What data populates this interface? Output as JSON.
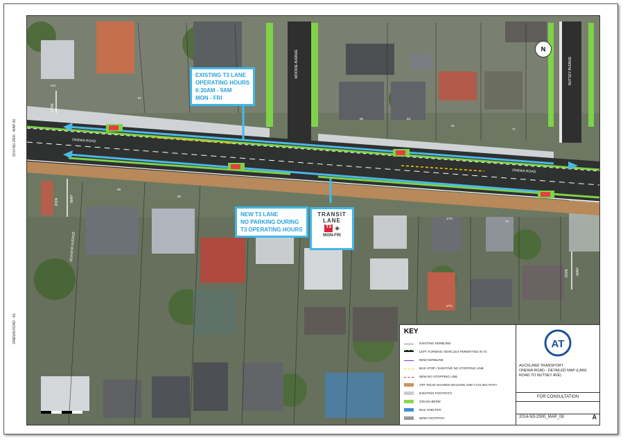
{
  "map": {
    "roads": {
      "main": "ONEWA ROAD",
      "main_right": "ONEWA ROAD",
      "side1": "MOODIE AVENUE",
      "side2": "NUTSEY AVENUE",
      "side3": "SEAVIEW AVENUE"
    },
    "match_lines": {
      "left_top": "LINE",
      "left_top_sub": "101",
      "left_mid": "MAP",
      "left_mid_sub": "JOIN",
      "right_mid": "MAP",
      "right_mid_sub": "JOIN"
    },
    "house_numbers": [
      "67",
      "65",
      "63",
      "61",
      "71",
      "99",
      "93",
      "1/74",
      "2/74",
      "72"
    ],
    "compass_label": "N"
  },
  "callouts": {
    "existing_t3": [
      "EXISTING T3 LANE",
      "OPERATING HOURS",
      "6:30AM - 9AM",
      "MON - FRI"
    ],
    "new_t3": [
      "NEW T3 LANE",
      "NO PARKING DURING",
      "T3 OPERATING HOURS"
    ]
  },
  "sign": {
    "line1": "TRANSIT",
    "line2": "LANE",
    "badge": "T3",
    "line3": "MON-FRI"
  },
  "key": {
    "title": "KEY",
    "items": [
      {
        "label": "EXISTING KERBLINE",
        "color": "#888888",
        "style": "line"
      },
      {
        "label": "LEFT TURNING VEHICLES PERMITTED IN T3",
        "color": "#1a1a1a",
        "style": "dashed-green"
      },
      {
        "label": "NEW KERBLINE",
        "color": "#8a2be2",
        "style": "line"
      },
      {
        "label": "BUS STOP / EXISTING NO STOPPING LINE",
        "color": "#f2c200",
        "style": "dashed"
      },
      {
        "label": "NEW NO STOPPING LINE",
        "color": "#e52222",
        "style": "dashed"
      },
      {
        "label": "OFF ROAD SHARED WALKING AND CYCLING PATH",
        "color": "#c8955e",
        "style": "fill"
      },
      {
        "label": "EXISTING FOOTPATH",
        "color": "#cccccc",
        "style": "fill"
      },
      {
        "label": "GRASS BERM",
        "color": "#8ed44e",
        "style": "fill"
      },
      {
        "label": "BUS SHELTER",
        "color": "#3f8fd8",
        "style": "fill"
      },
      {
        "label": "NEW FOOTPATH",
        "color": "#999999",
        "style": "fill"
      }
    ]
  },
  "title_block": {
    "org": "AUCKLAND TRANSPORT",
    "line2": "ONEWA ROAD - DETAILED MAP (LAKE",
    "line3": "ROAD TO NUTSEY AVE)",
    "status": "FOR CONSULTATION",
    "drawing_no": "2014-N3-2900_MAP_08",
    "revision": "A",
    "logo_text": "AT"
  },
  "colors": {
    "road": "#3a3a3a",
    "t3_lane_marker": "#4ab8e8",
    "grass": "#7ed348",
    "shared_path": "#b8895a"
  }
}
